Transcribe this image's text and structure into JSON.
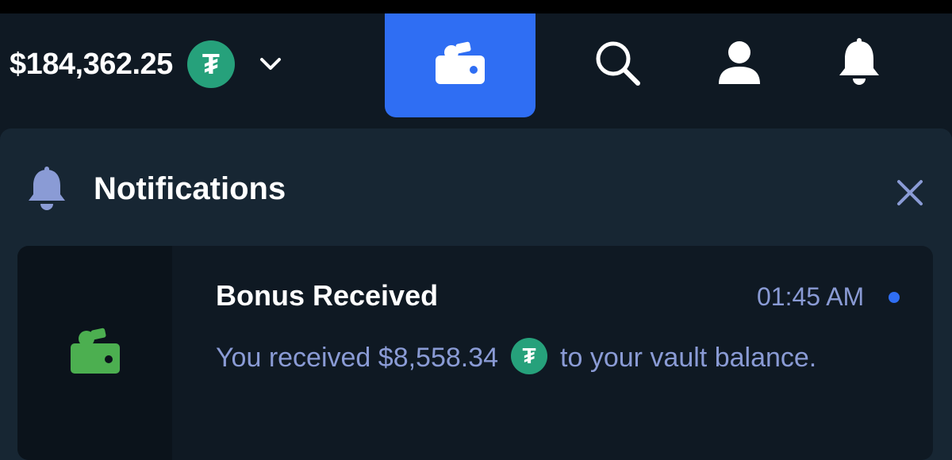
{
  "header": {
    "balance": "$184,362.25",
    "currency_icon": "tether-icon",
    "dropdown_icon": "chevron-down-icon",
    "wallet_icon": "wallet-icon",
    "search_icon": "search-icon",
    "profile_icon": "user-icon",
    "notifications_icon": "bell-icon",
    "accent_color": "#2f6ef3"
  },
  "panel": {
    "title": "Notifications",
    "icon": "bell-icon",
    "close_icon": "close-icon"
  },
  "notifications": [
    {
      "title": "Bonus Received",
      "time": "01:45 AM",
      "unread": true,
      "icon": "wallet-icon",
      "icon_color": "#4caf50",
      "body_prefix": "You received $8,558.34",
      "body_suffix": "to your vault balance."
    }
  ],
  "colors": {
    "background": "#0f1923",
    "panel": "#172633",
    "tether": "#26a17b",
    "muted_text": "#8a9bd5"
  }
}
